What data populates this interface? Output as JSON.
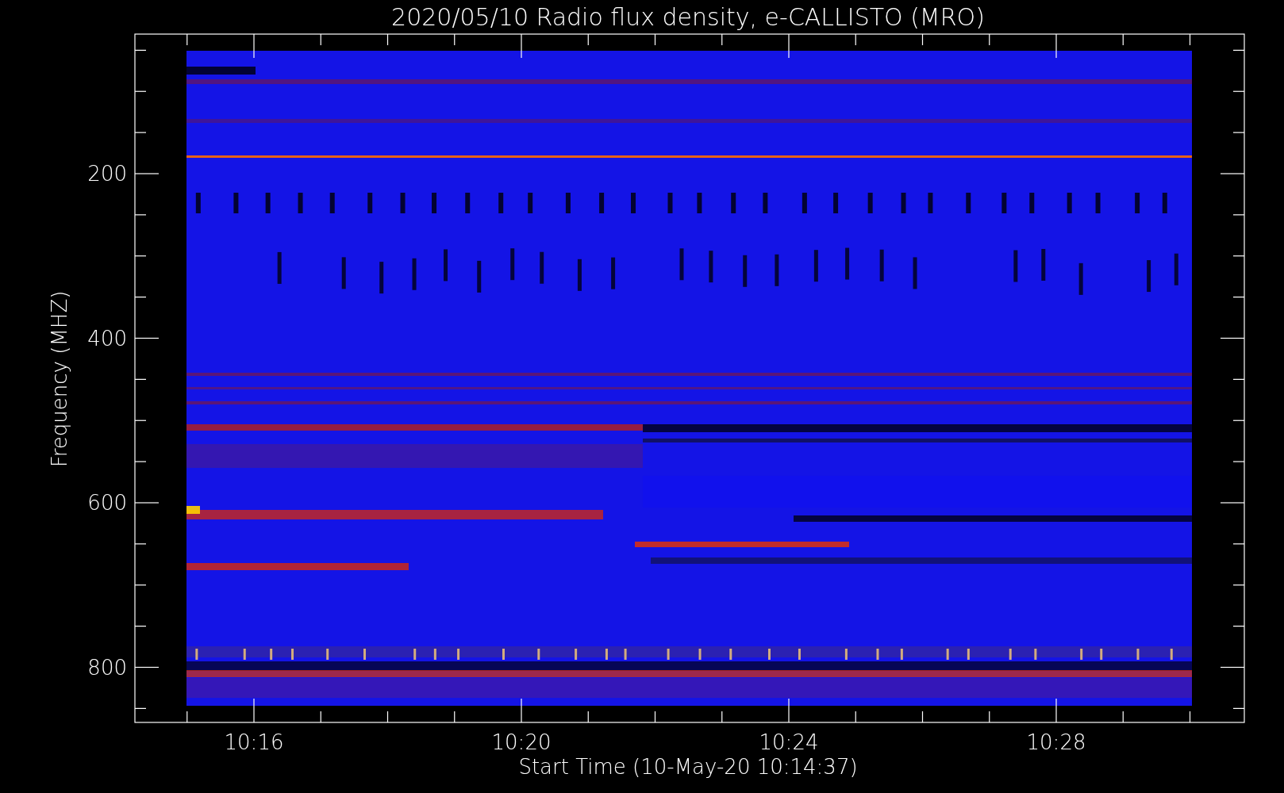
{
  "plot": {
    "title": "2020/05/10  Radio flux density, e-CALLISTO (MRO)",
    "xlabel": "Start Time (10-May-20 10:14:37)",
    "ylabel": "Frequency (MHZ)",
    "x_tick_labels": [
      "10:16",
      "10:20",
      "10:24",
      "10:28"
    ],
    "y_tick_labels": [
      "200",
      "400",
      "600",
      "800"
    ]
  }
}
